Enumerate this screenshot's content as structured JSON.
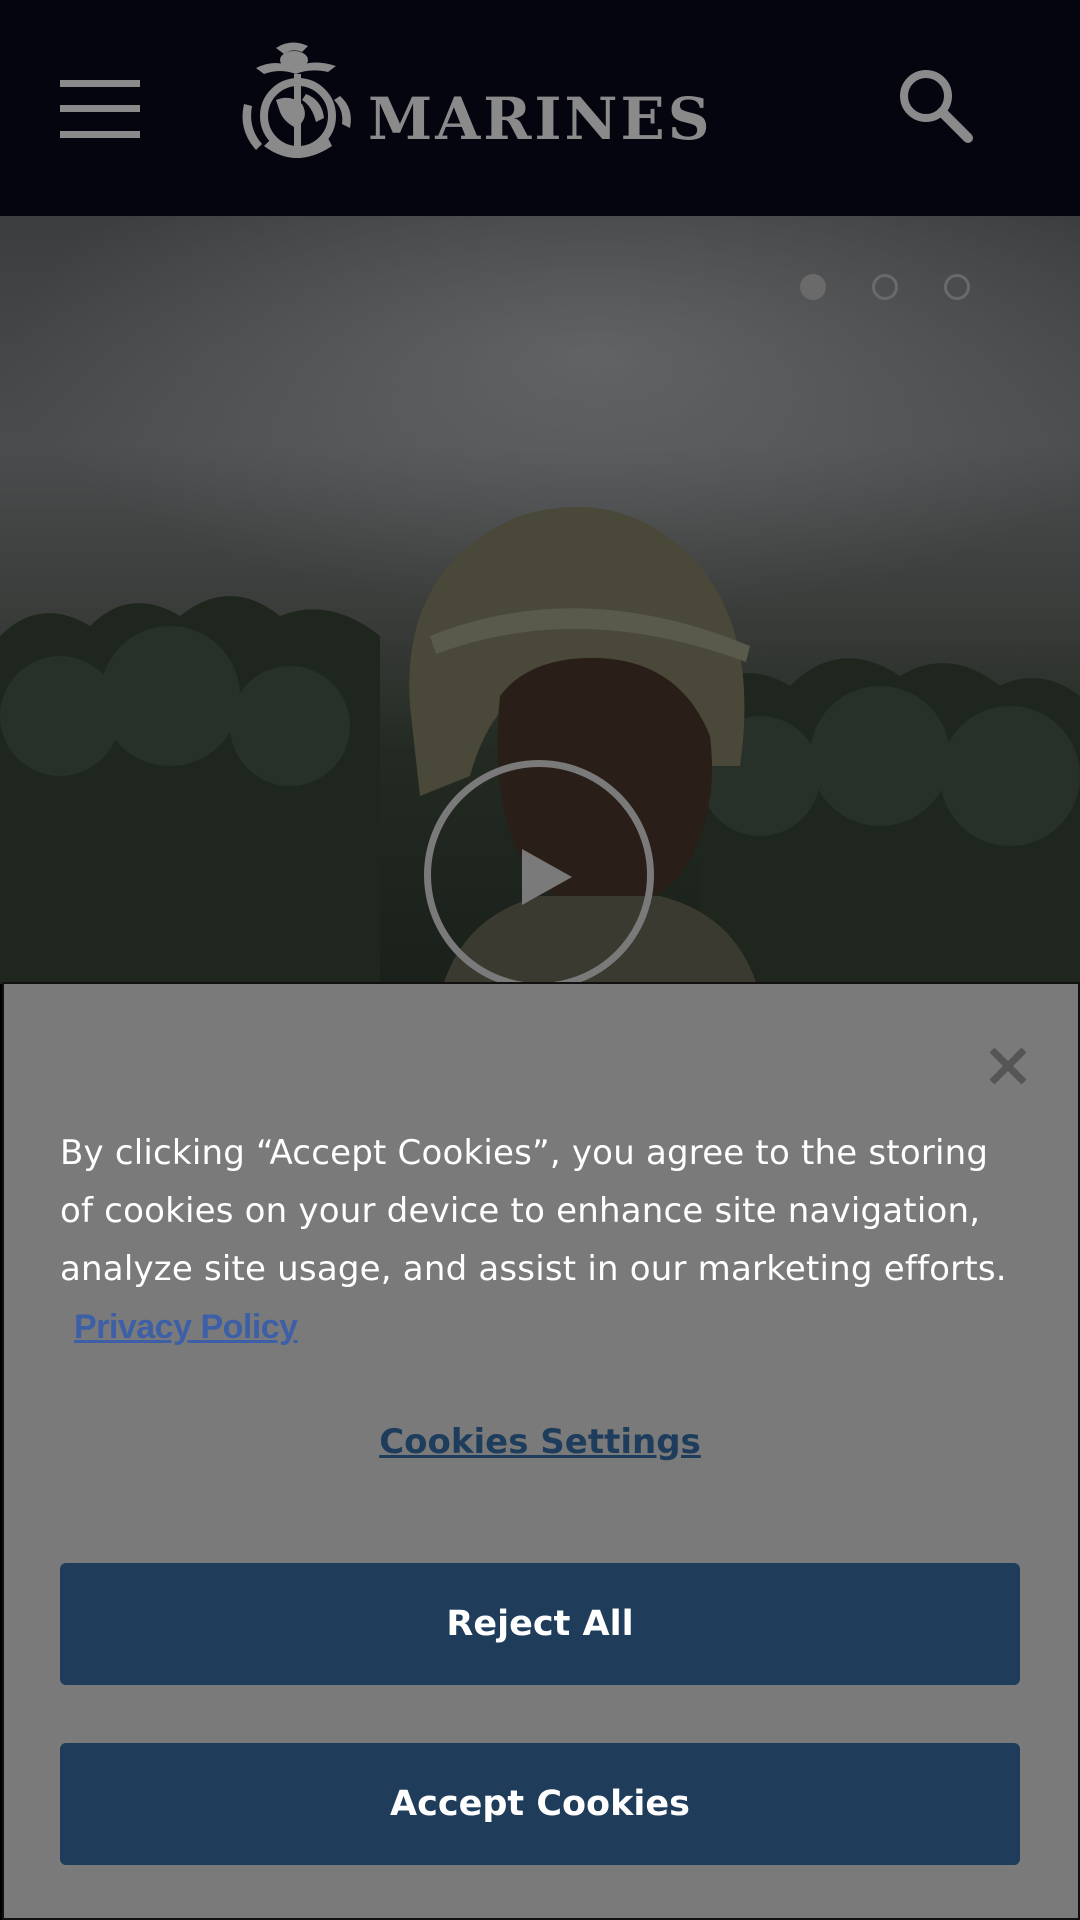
{
  "header": {
    "logo_text": "MARINES",
    "menu_icon": "hamburger-menu-icon",
    "search_icon": "search-icon",
    "background": "#050510"
  },
  "hero": {
    "carousel": {
      "total": 3,
      "active": 1
    },
    "play_icon": "play-icon"
  },
  "cookie_banner": {
    "message": "By clicking “Accept Cookies”, you agree to the storing of cookies on your device to enhance site navigation, analyze site usage, and assist in our marketing efforts.",
    "privacy_link": "Privacy Policy",
    "settings_link": "Cookies Settings",
    "reject_label": "Reject All",
    "accept_label": "Accept Cookies",
    "close_icon": "close-icon",
    "button_color": "#1f3c5a",
    "link_color": "#3d5fa8"
  }
}
